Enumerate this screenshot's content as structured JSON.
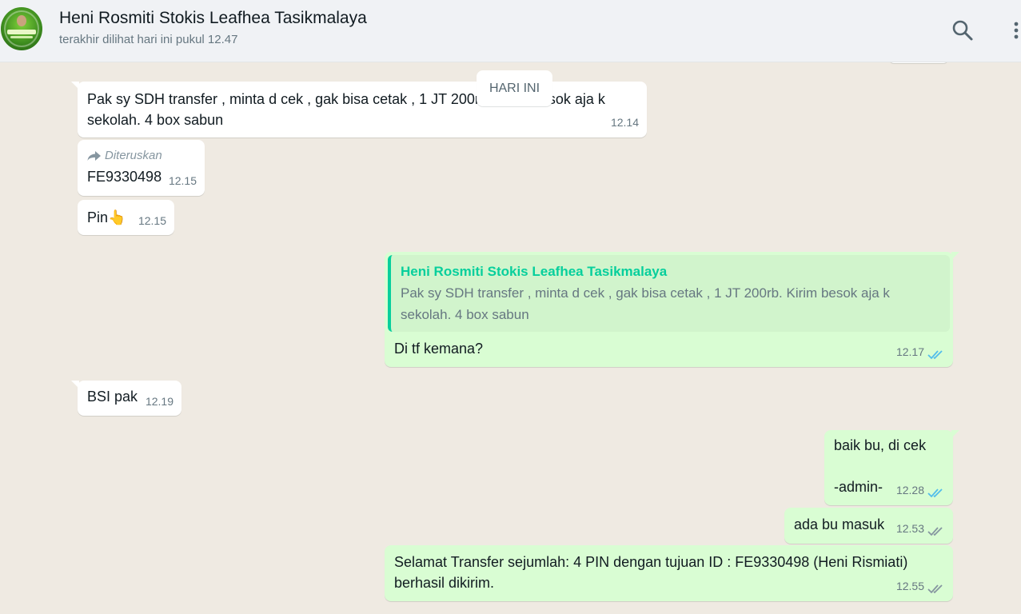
{
  "header": {
    "contact_name": "Heni Rosmiti Stokis Leafhea Tasikmalaya",
    "status": "terakhir dilihat hari ini pukul 12.47",
    "search_icon": "search-icon",
    "menu_icon": "more-vertical-icon"
  },
  "colors": {
    "incoming_bubble": "#ffffff",
    "outgoing_bubble": "#d9fdd3",
    "quote_accent": "#06cf9c",
    "read_ticks": "#53bdeb",
    "delivered_ticks": "#8696a0",
    "background": "#efeae2"
  },
  "date_separator": "HARI INI",
  "messages": [
    {
      "dir": "in",
      "lines": [
        "Pak sy SDH transfer , minta d cek , gak bisa cetak , 1 JT 200rb. Kirim besok aja k",
        "sekolah. 4 box sabun"
      ],
      "time": "12.14"
    },
    {
      "dir": "in",
      "forwarded_label": "Diteruskan",
      "text": "FE9330498",
      "time": "12.15"
    },
    {
      "dir": "in",
      "text": "Pin👆",
      "time": "12.15"
    },
    {
      "dir": "out",
      "quote_author": "Heni Rosmiti Stokis Leafhea Tasikmalaya",
      "quote_lines": [
        "Pak sy SDH transfer , minta d cek , gak bisa cetak , 1 JT 200rb. Kirim besok aja k",
        "sekolah. 4 box sabun"
      ],
      "text": "Di tf kemana?",
      "time": "12.17",
      "status": "read"
    },
    {
      "dir": "in",
      "text": "BSI pak",
      "time": "12.19"
    },
    {
      "dir": "out",
      "lines": [
        "baik bu, di cek",
        "",
        "-admin-"
      ],
      "time": "12.28",
      "status": "read"
    },
    {
      "dir": "out",
      "text": "ada bu masuk",
      "time": "12.53",
      "status": "delivered"
    },
    {
      "dir": "out",
      "lines": [
        "Selamat Transfer sejumlah: 4 PIN dengan tujuan ID : FE9330498 (Heni Rismiati)",
        "berhasil dikirim."
      ],
      "time": "12.55",
      "status": "delivered"
    }
  ]
}
